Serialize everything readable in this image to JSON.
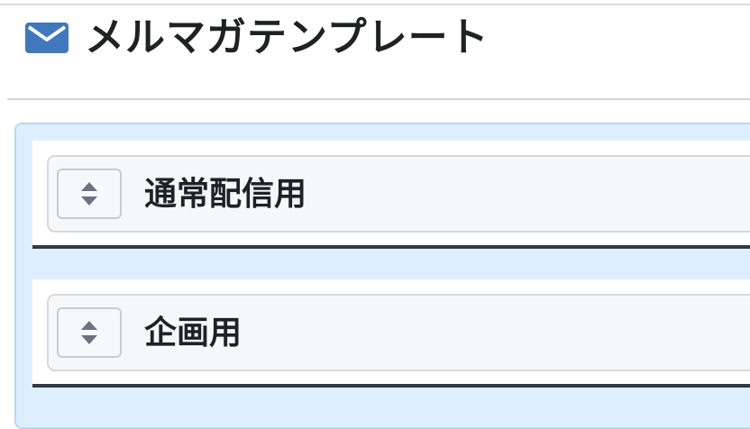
{
  "header": {
    "icon": "envelope-icon",
    "title": "メルマガテンプレート"
  },
  "templates": [
    {
      "label": "通常配信用",
      "handle_icon": "sort-icon"
    },
    {
      "label": "企画用",
      "handle_icon": "sort-icon"
    }
  ],
  "colors": {
    "accent": "#3f78bd",
    "panel_background": "#ddeffd",
    "panel_border": "#bcd7ef",
    "item_underline": "#2f3a44",
    "handle_icon": "#6b7280"
  }
}
